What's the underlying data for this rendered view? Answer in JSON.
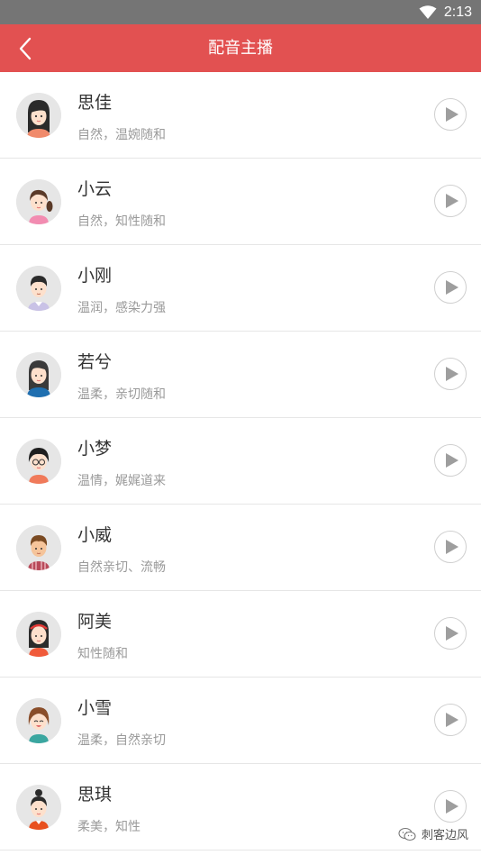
{
  "status_bar": {
    "time": "2:13",
    "wifi_icon": "wifi-icon"
  },
  "app_bar": {
    "title": "配音主播",
    "back_icon": "chevron-left-icon",
    "color": "#e25151"
  },
  "voices": [
    {
      "name": "思佳",
      "desc": "自然，温婉随和",
      "avatar": "female-long-black-hair-avatar"
    },
    {
      "name": "小云",
      "desc": "自然，知性随和",
      "avatar": "female-ponytail-avatar"
    },
    {
      "name": "小刚",
      "desc": "温润，感染力强",
      "avatar": "male-short-hair-avatar"
    },
    {
      "name": "若兮",
      "desc": "温柔，亲切随和",
      "avatar": "female-blue-top-avatar"
    },
    {
      "name": "小梦",
      "desc": "温情，娓娓道来",
      "avatar": "female-glasses-avatar"
    },
    {
      "name": "小威",
      "desc": "自然亲切、流畅",
      "avatar": "male-brown-hair-avatar"
    },
    {
      "name": "阿美",
      "desc": "知性随和",
      "avatar": "female-headband-avatar"
    },
    {
      "name": "小雪",
      "desc": "温柔，自然亲切",
      "avatar": "female-laughing-avatar"
    },
    {
      "name": "思琪",
      "desc": "柔美，知性",
      "avatar": "female-bun-avatar"
    }
  ],
  "play_icon": "play-icon",
  "watermark": {
    "text": "刺客边风",
    "icon": "wechat-icon"
  }
}
